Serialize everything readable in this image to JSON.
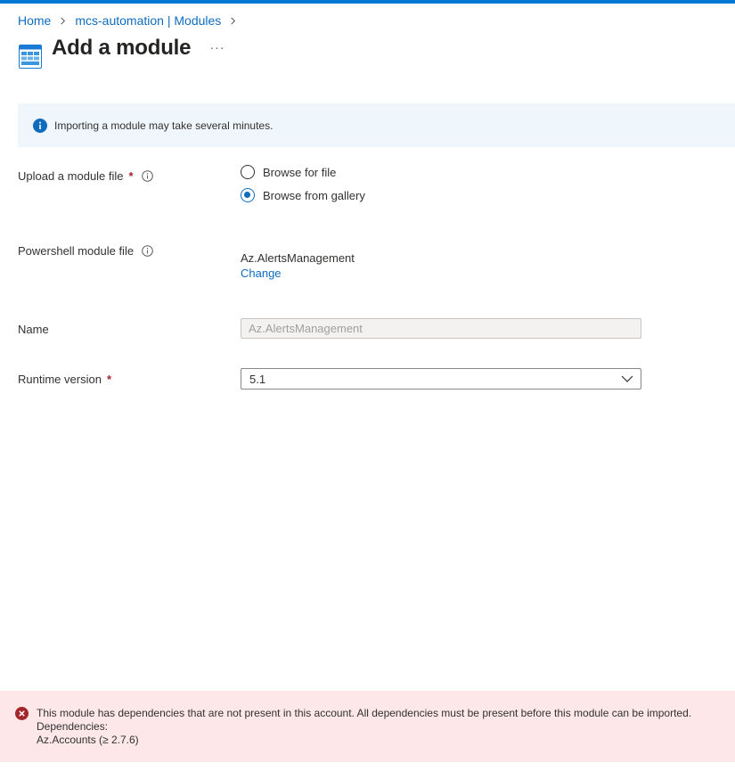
{
  "breadcrumb": {
    "items": [
      "Home",
      "mcs-automation | Modules"
    ]
  },
  "header": {
    "title": "Add a module",
    "more_label": "···",
    "icon": "module-grid-icon"
  },
  "info_banner": {
    "icon": "info-icon",
    "text": "Importing a module may take several minutes."
  },
  "form": {
    "upload": {
      "label": "Upload a module file",
      "required_marker": "*",
      "options": [
        {
          "label": "Browse for file",
          "selected": false
        },
        {
          "label": "Browse from gallery",
          "selected": true
        }
      ]
    },
    "powershell_file": {
      "label": "Powershell module file",
      "value": "Az.AlertsManagement",
      "change_label": "Change"
    },
    "name": {
      "label": "Name",
      "value": "Az.AlertsManagement"
    },
    "runtime": {
      "label": "Runtime version",
      "required_marker": "*",
      "value": "5.1"
    }
  },
  "error_banner": {
    "icon": "error-icon",
    "message": "This module has dependencies that are not present in this account. All dependencies must be present before this module can be imported.",
    "dependencies_label": "Dependencies:",
    "dependency": "Az.Accounts (≥ 2.7.6)"
  },
  "colors": {
    "accent": "#0078d4",
    "link": "#0f6cbd",
    "required": "#a4262c",
    "info_bg": "#eff6fc",
    "error_bg": "#fde7e9",
    "error_icon": "#a4262c"
  }
}
